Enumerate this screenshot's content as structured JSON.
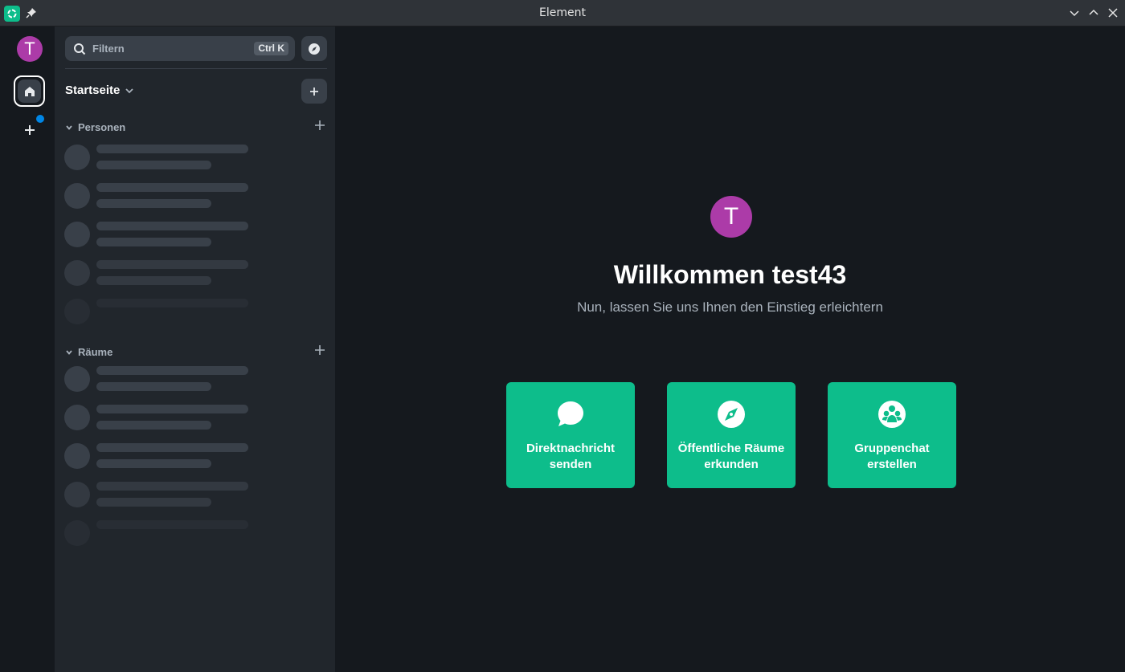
{
  "window": {
    "title": "Element"
  },
  "spaces": {
    "user_initial": "T"
  },
  "roomlist": {
    "search_placeholder": "Filtern",
    "search_shortcut": "Ctrl K",
    "home_title": "Startseite",
    "sections": [
      {
        "label": "Personen"
      },
      {
        "label": "Räume"
      }
    ]
  },
  "welcome": {
    "avatar_initial": "T",
    "title": "Willkommen test43",
    "subtitle": "Nun, lassen Sie uns Ihnen den Einstieg erleichtern",
    "cards": [
      {
        "label": "Direktnachricht\nsenden",
        "icon": "chat-bubble-icon"
      },
      {
        "label": "Öffentliche Räume\nerkunden",
        "icon": "compass-icon"
      },
      {
        "label": "Gruppenchat\nerstellen",
        "icon": "group-icon"
      }
    ]
  },
  "colors": {
    "accent": "#0dbd8b",
    "avatar": "#ac3ba8",
    "notification": "#0086e6"
  }
}
